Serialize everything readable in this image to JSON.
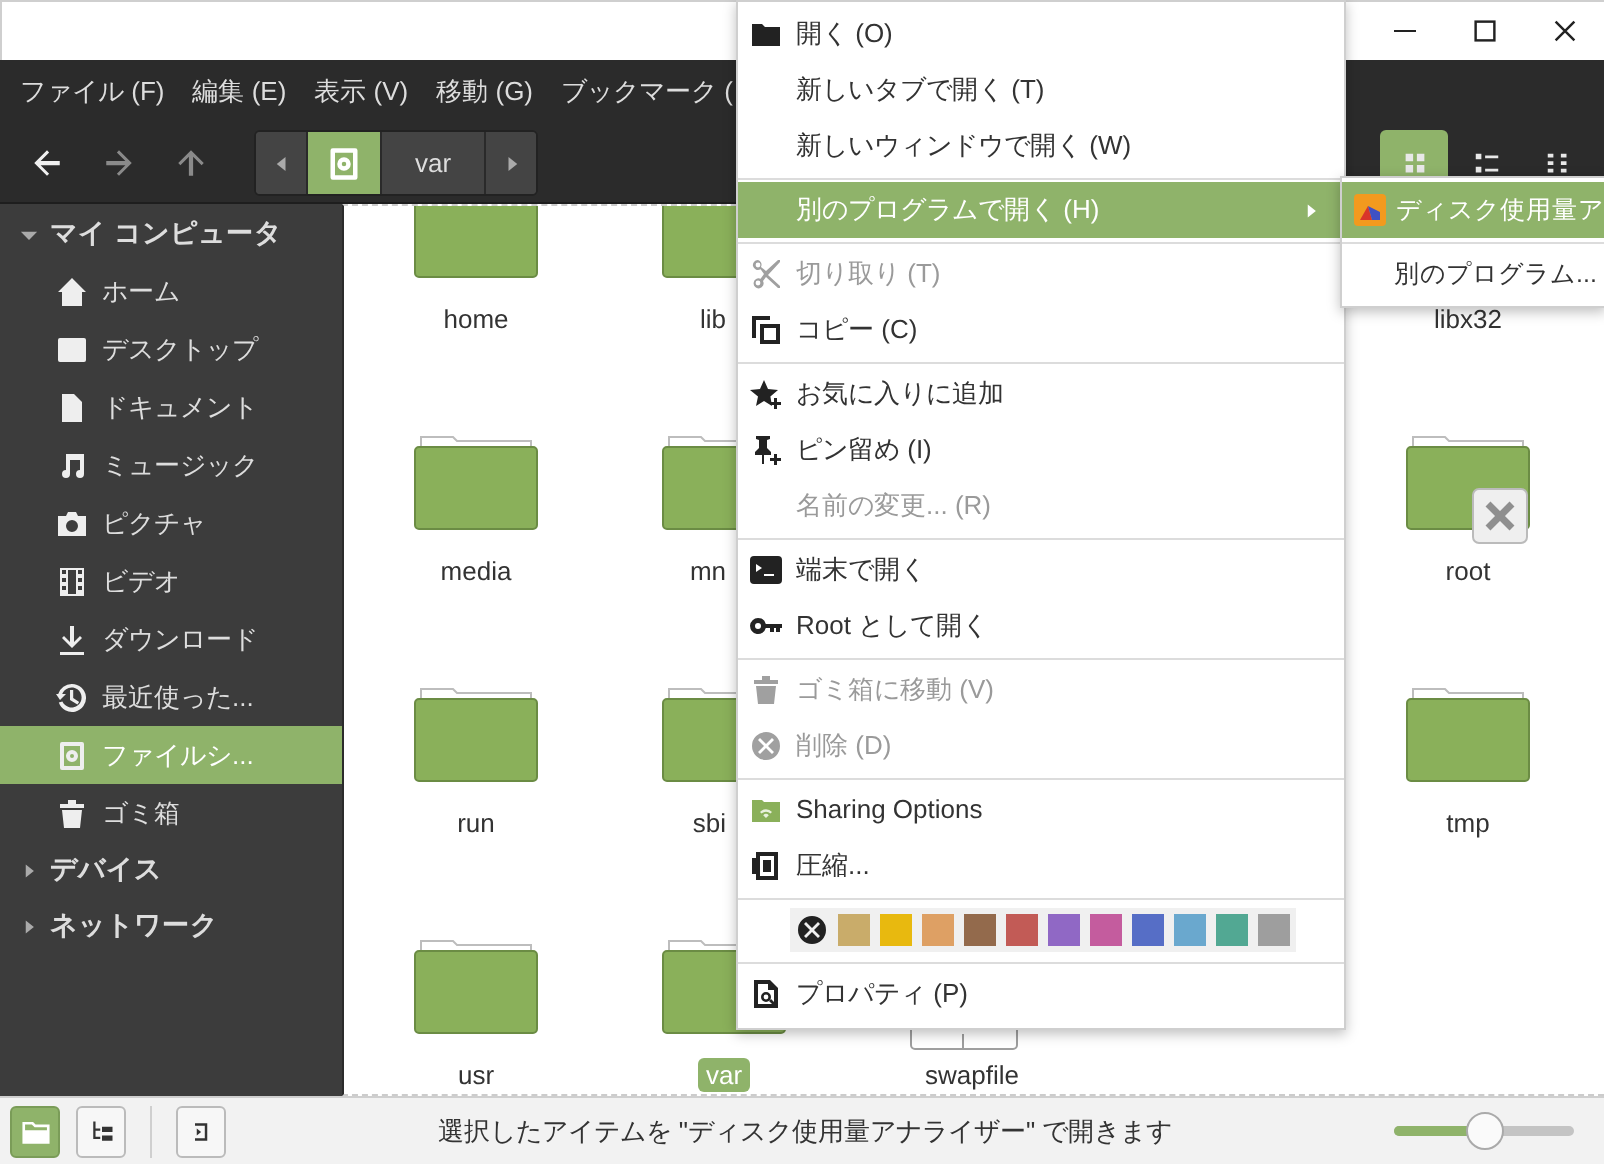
{
  "menubar": [
    {
      "label": "ファイル (F)"
    },
    {
      "label": "編集 (E)"
    },
    {
      "label": "表示 (V)"
    },
    {
      "label": "移動 (G)"
    },
    {
      "label": "ブックマーク ("
    }
  ],
  "toolbar": {
    "back": {
      "disabled": false
    },
    "forward": {
      "disabled": true
    },
    "up": {
      "disabled": true
    }
  },
  "pathbar": {
    "segments": [
      {
        "kind": "icon",
        "selected": true
      },
      {
        "kind": "text",
        "label": "var",
        "selected": false
      }
    ]
  },
  "view_modes": [
    {
      "selected": true
    },
    {
      "selected": false
    },
    {
      "selected": false
    }
  ],
  "sidebar": {
    "sections": [
      {
        "label": "マイ コンピュータ",
        "expanded": true,
        "children": [
          {
            "label": "ホーム",
            "selected": false
          },
          {
            "label": "デスクトップ",
            "selected": false
          },
          {
            "label": "ドキュメント",
            "selected": false
          },
          {
            "label": "ミュージック",
            "selected": false
          },
          {
            "label": "ピクチャ",
            "selected": false
          },
          {
            "label": "ビデオ",
            "selected": false
          },
          {
            "label": "ダウンロード",
            "selected": false
          },
          {
            "label": "最近使った...",
            "selected": false
          },
          {
            "label": "ファイルシ...",
            "selected": true
          },
          {
            "label": "ゴミ箱",
            "selected": false
          }
        ]
      },
      {
        "label": "デバイス",
        "expanded": false
      },
      {
        "label": "ネットワーク",
        "expanded": false
      }
    ]
  },
  "files": [
    {
      "name": "home",
      "kind": "folder",
      "selected": false,
      "unreadable": false
    },
    {
      "name": "lib",
      "kind": "folder",
      "selected": false,
      "unreadable": false
    },
    {
      "name": "libx32",
      "kind": "folder",
      "selected": false,
      "unreadable": false
    },
    {
      "name": "media",
      "kind": "folder",
      "selected": false,
      "unreadable": false
    },
    {
      "name": "mn",
      "kind": "folder",
      "selected": false,
      "unreadable": false
    },
    {
      "name": "root",
      "kind": "folder",
      "selected": false,
      "unreadable": true
    },
    {
      "name": "run",
      "kind": "folder",
      "selected": false,
      "unreadable": false
    },
    {
      "name": "sbi",
      "kind": "folder",
      "selected": false,
      "unreadable": false
    },
    {
      "name": "tmp",
      "kind": "folder",
      "selected": false,
      "unreadable": false
    },
    {
      "name": "usr",
      "kind": "folder",
      "selected": false,
      "unreadable": false
    },
    {
      "name": "var",
      "kind": "folder",
      "selected": true,
      "unreadable": false
    },
    {
      "name": "swapfile",
      "kind": "file",
      "selected": false,
      "unreadable": false
    }
  ],
  "context_menu": {
    "items": [
      {
        "kind": "item",
        "label": "開く (O)",
        "disabled": false,
        "highlighted": false,
        "submenu": false
      },
      {
        "kind": "item",
        "label": "新しいタブで開く (T)",
        "disabled": false,
        "highlighted": false,
        "submenu": false
      },
      {
        "kind": "item",
        "label": "新しいウィンドウで開く (W)",
        "disabled": false,
        "highlighted": false,
        "submenu": false
      },
      {
        "kind": "separator"
      },
      {
        "kind": "item",
        "label": "別のプログラムで開く (H)",
        "disabled": false,
        "highlighted": true,
        "submenu": true
      },
      {
        "kind": "separator"
      },
      {
        "kind": "item",
        "label": "切り取り (T)",
        "disabled": true,
        "highlighted": false,
        "submenu": false
      },
      {
        "kind": "item",
        "label": "コピー (C)",
        "disabled": false,
        "highlighted": false,
        "submenu": false
      },
      {
        "kind": "separator"
      },
      {
        "kind": "item",
        "label": "お気に入りに追加",
        "disabled": false,
        "highlighted": false,
        "submenu": false
      },
      {
        "kind": "item",
        "label": "ピン留め (I)",
        "disabled": false,
        "highlighted": false,
        "submenu": false
      },
      {
        "kind": "item",
        "label": "名前の変更... (R)",
        "disabled": true,
        "highlighted": false,
        "submenu": false
      },
      {
        "kind": "separator"
      },
      {
        "kind": "item",
        "label": "端末で開く",
        "disabled": false,
        "highlighted": false,
        "submenu": false
      },
      {
        "kind": "item",
        "label": "Root として開く",
        "disabled": false,
        "highlighted": false,
        "submenu": false
      },
      {
        "kind": "separator"
      },
      {
        "kind": "item",
        "label": "ゴミ箱に移動 (V)",
        "disabled": true,
        "highlighted": false,
        "submenu": false
      },
      {
        "kind": "item",
        "label": "削除 (D)",
        "disabled": true,
        "highlighted": false,
        "submenu": false
      },
      {
        "kind": "separator"
      },
      {
        "kind": "item",
        "label": "Sharing Options",
        "disabled": false,
        "highlighted": false,
        "submenu": false
      },
      {
        "kind": "item",
        "label": "圧縮...",
        "disabled": false,
        "highlighted": false,
        "submenu": false
      },
      {
        "kind": "separator"
      },
      {
        "kind": "colors",
        "colors": [
          {
            "color": "#c9ac6a"
          },
          {
            "color": "#e8b90f"
          },
          {
            "color": "#dea064"
          },
          {
            "color": "#936a4c"
          },
          {
            "color": "#c25b56"
          },
          {
            "color": "#9068c5"
          },
          {
            "color": "#c45c9e"
          },
          {
            "color": "#566ec6"
          },
          {
            "color": "#6aa8ce"
          },
          {
            "color": "#52a893"
          },
          {
            "color": "#9e9e9e"
          }
        ]
      },
      {
        "kind": "separator"
      },
      {
        "kind": "item",
        "label": "プロパティ (P)",
        "disabled": false,
        "highlighted": false,
        "submenu": false
      }
    ]
  },
  "submenu": {
    "items": [
      {
        "kind": "app",
        "label": "ディスク使用量ア",
        "highlighted": true
      },
      {
        "kind": "separator"
      },
      {
        "kind": "item",
        "label": "別のプログラム...",
        "highlighted": false
      }
    ]
  },
  "status_bar": {
    "pane_buttons": [
      {
        "selected": true
      },
      {
        "selected": false
      }
    ],
    "message": "選択したアイテムを \"ディスク使用量アナライザー\" で開きます",
    "zoom": {
      "level": 0.5
    }
  }
}
